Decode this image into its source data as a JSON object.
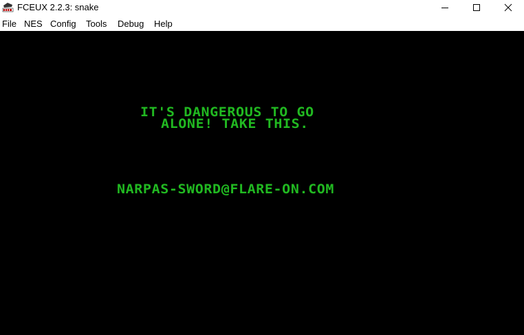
{
  "window": {
    "title": "FCEUX 2.2.3: snake",
    "icon": "fceux-app-icon",
    "controls": [
      "minimize-icon",
      "maximize-icon",
      "close-icon"
    ]
  },
  "menu": {
    "items": [
      "File",
      "NES",
      "Config",
      "Tools",
      "Debug",
      "Help"
    ]
  },
  "game": {
    "line1": "IT'S DANGEROUS TO GO",
    "line2": "ALONE! TAKE THIS.",
    "email": "NARPAS-SWORD@FLARE-ON.COM",
    "text_color": "#21b921",
    "background_color": "#000000"
  }
}
